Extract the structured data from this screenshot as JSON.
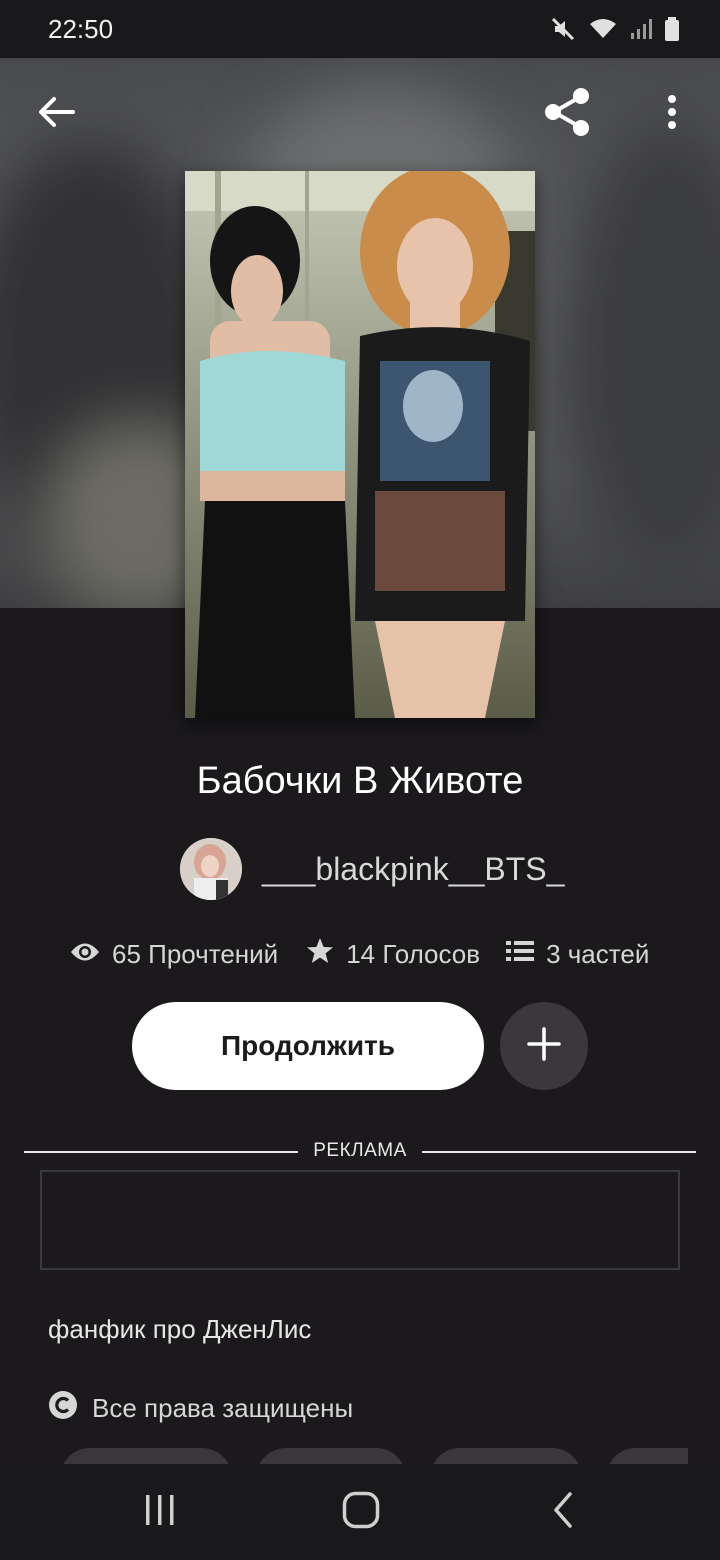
{
  "status_bar": {
    "time": "22:50",
    "icons": [
      "mute-icon",
      "wifi-icon",
      "signal-icon",
      "battery-icon"
    ]
  },
  "top_bar": {
    "icons": [
      "back-arrow-icon",
      "share-icon",
      "more-vertical-icon"
    ]
  },
  "story": {
    "title": "Бабочки В Животе",
    "author": "___blackpink__BTS_",
    "description": "фанфик про ДженЛис",
    "copyright": "Все права защищены"
  },
  "stats": {
    "reads": "65 Прочтений",
    "votes": "14 Голосов",
    "parts": "3 частей"
  },
  "actions": {
    "continue_label": "Продолжить"
  },
  "ad": {
    "label": "РЕКЛАМА"
  },
  "colors": {
    "background": "#1b191c",
    "primary_button": "#ffffff",
    "secondary_button": "#3a383c"
  },
  "nav_bar": {
    "icons": [
      "recent-apps-icon",
      "home-icon",
      "back-icon"
    ]
  }
}
